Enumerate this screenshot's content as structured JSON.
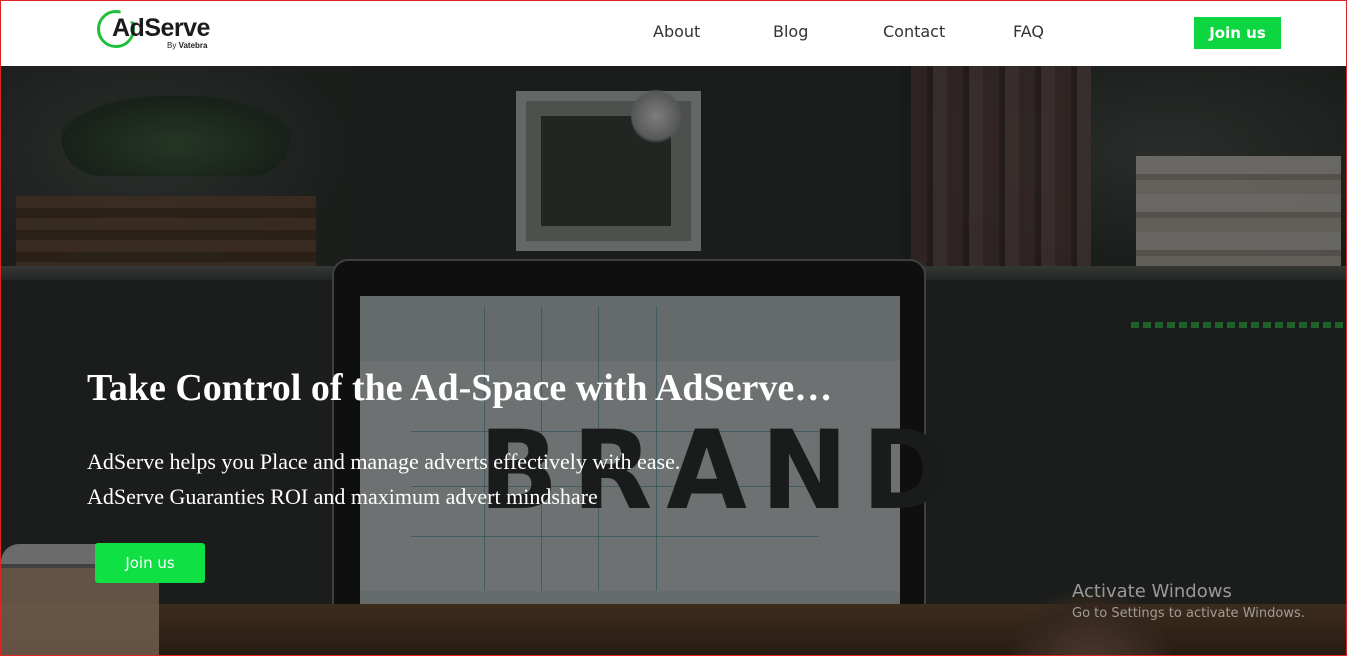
{
  "logo": {
    "word": "AdServe",
    "by_prefix": "By",
    "by_name": "Vatebra"
  },
  "nav": {
    "links": [
      "About",
      "Blog",
      "Contact",
      "FAQ"
    ],
    "join_label": "Join us"
  },
  "colors": {
    "accent_green": "#0ed641",
    "frame_border": "#e02424"
  },
  "hero": {
    "title": "Take Control of the Ad-Space with AdServe…",
    "line1": "AdServe helps you Place and manage adverts effectively with ease.",
    "line2": "AdServe Guaranties ROI and maximum advert mindshare",
    "join_label": "Join us",
    "background_text": "BRAND"
  },
  "watermark": {
    "title": "Activate Windows",
    "subtitle": "Go to Settings to activate Windows."
  }
}
